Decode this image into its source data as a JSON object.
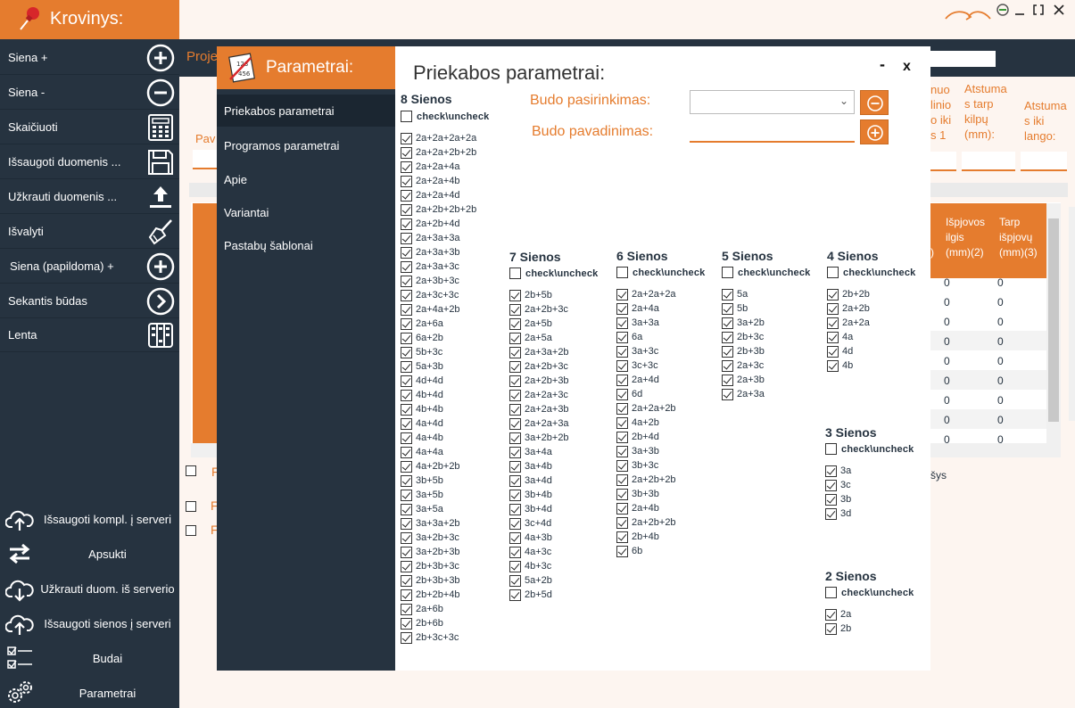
{
  "app": {
    "title": "Krovinys:"
  },
  "sidebar": {
    "items": [
      {
        "label": "Siena +",
        "icon": "plus-circle-icon"
      },
      {
        "label": "Siena -",
        "icon": "minus-circle-icon"
      },
      {
        "label": "Skaičiuoti",
        "icon": "calculator-icon"
      },
      {
        "label": "Išsaugoti duomenis ...",
        "icon": "save-icon"
      },
      {
        "label": "Užkrauti duomenis ...",
        "icon": "upload-icon"
      },
      {
        "label": "Išvalyti",
        "icon": "broom-icon"
      },
      {
        "label": "Siena (papildoma) +",
        "icon": "plus-circle-icon"
      },
      {
        "label": "Sekantis būdas",
        "icon": "chevron-right-circle-icon"
      },
      {
        "label": "Lenta",
        "icon": "board-icon"
      }
    ],
    "bottom": [
      {
        "label": "Išsaugoti kompl. į serveri",
        "icon": "cloud-upload-icon"
      },
      {
        "label": "Apsukti",
        "icon": "rotate-icon"
      },
      {
        "label": "Užkrauti duom. iš serverio",
        "icon": "cloud-download-icon"
      },
      {
        "label": "Išsaugoti sienos į serveri",
        "icon": "cloud-upload-icon"
      },
      {
        "label": "Budai",
        "icon": "checklist-icon"
      },
      {
        "label": "Parametrai",
        "icon": "gears-icon"
      }
    ]
  },
  "background": {
    "proj_label": "Proje",
    "pav_label": "Pav",
    "columns": [
      {
        "text": "nuo\nlinio\no iki\ns 1"
      },
      {
        "text": "Atstuma\ns tarp\nkilpų\n(mm):"
      },
      {
        "text": "Atstuma\ns iki\nlango:"
      }
    ],
    "table_headers": [
      {
        "text": "Išpjovos\nilgis\n(mm)(2)"
      },
      {
        "text": "Tarp\nišpjovų\n(mm)(3)"
      }
    ],
    "table_first_col_suffix": ")",
    "cell_value": "0",
    "sys_text": "šys",
    "letter_f": "F"
  },
  "modal": {
    "nav_title": "Parametrai:",
    "nav_items": [
      "Priekabos parametrai",
      "Programos parametrai",
      "Apie",
      "Variantai",
      "Pastabų šablonai"
    ],
    "title": "Priekabos parametrai:",
    "minimize": "-",
    "close": "x",
    "budo_pasirinkimas_label": "Budo pasirinkimas:",
    "budo_pavadinimas_label": "Budo pavadinimas:",
    "check_uncheck": "check\\uncheck",
    "groups": [
      {
        "title": "8 Sienos",
        "items": [
          "2a+2a+2a+2a",
          "2a+2a+2b+2b",
          "2a+2a+4a",
          "2a+2a+4b",
          "2a+2a+4d",
          "2a+2b+2b+2b",
          "2a+2b+4d",
          "2a+3a+3a",
          "2a+3a+3b",
          "2a+3a+3c",
          "2a+3b+3c",
          "2a+3c+3c",
          "2a+4a+2b",
          "2a+6a",
          "6a+2b",
          "5b+3c",
          "5a+3b",
          "4d+4d",
          "4b+4d",
          "4b+4b",
          "4a+4d",
          "4a+4b",
          "4a+4a",
          "4a+2b+2b",
          "3b+5b",
          "3a+5b",
          "3a+5a",
          "3a+3a+2b",
          "3a+2b+3c",
          "3a+2b+3b",
          "2b+3b+3c",
          "2b+3b+3b",
          "2b+2b+4b",
          "2a+6b",
          "2b+6b",
          "2b+3c+3c"
        ]
      },
      {
        "title": "7 Sienos",
        "items": [
          "2b+5b",
          "2a+2b+3c",
          "2a+5b",
          "2a+5a",
          "2a+3a+2b",
          "2a+2b+3c",
          "2a+2b+3b",
          "2a+2a+3c",
          "2a+2a+3b",
          "2a+2a+3a",
          "3a+2b+2b",
          "3a+4a",
          "3a+4b",
          "3a+4d",
          "3b+4b",
          "3b+4d",
          "3c+4d",
          "4a+3b",
          "4a+3c",
          "4b+3c",
          "5a+2b",
          "2b+5d"
        ]
      },
      {
        "title": "6 Sienos",
        "items": [
          "2a+2a+2a",
          "2a+4a",
          "3a+3a",
          "6a",
          "3a+3c",
          "3c+3c",
          "2a+4d",
          "6d",
          "2a+2a+2b",
          "4a+2b",
          "2b+4d",
          "3a+3b",
          "3b+3c",
          "2a+2b+2b",
          "3b+3b",
          "2a+4b",
          "2a+2b+2b",
          "2b+4b",
          "6b"
        ]
      },
      {
        "title": "5 Sienos",
        "items": [
          "5a",
          "5b",
          "3a+2b",
          "2b+3c",
          "2b+3b",
          "2a+3c",
          "2a+3b",
          "2a+3a"
        ]
      },
      {
        "title": "4 Sienos",
        "items": [
          "2b+2b",
          "2a+2b",
          "2a+2a",
          "4a",
          "4d",
          "4b"
        ]
      },
      {
        "title": "3 Sienos",
        "items": [
          "3a",
          "3c",
          "3b",
          "3d"
        ]
      },
      {
        "title": "2 Sienos",
        "items": [
          "2a",
          "2b"
        ]
      }
    ]
  },
  "colors": {
    "accent": "#e57c2e",
    "dark": "#263340",
    "nav_active": "#1b2631"
  }
}
